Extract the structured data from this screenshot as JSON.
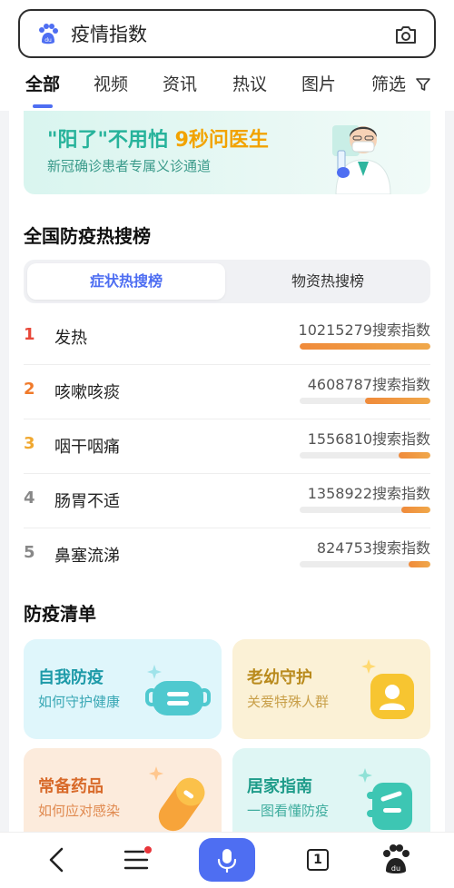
{
  "search": {
    "query": "疫情指数"
  },
  "tabs": [
    {
      "label": "全部",
      "active": true
    },
    {
      "label": "视频"
    },
    {
      "label": "资讯"
    },
    {
      "label": "热议"
    },
    {
      "label": "图片"
    },
    {
      "label": "筛选"
    }
  ],
  "banner": {
    "title_quote": "\"阳了\"不用怕",
    "title_highlight": "9秒问医生",
    "subtitle": "新冠确诊患者专属义诊通道"
  },
  "hot_search": {
    "title": "全国防疫热搜榜",
    "segments": [
      "症状热搜榜",
      "物资热搜榜"
    ],
    "selected": "症状热搜榜",
    "items": [
      {
        "rank": "1",
        "name": "发热",
        "index_text": "10215279搜索指数",
        "level": 1.0,
        "color": "#e8483a"
      },
      {
        "rank": "2",
        "name": "咳嗽咳痰",
        "index_text": "4608787搜索指数",
        "level": 0.5,
        "color": "#f07a2a"
      },
      {
        "rank": "3",
        "name": "咽干咽痛",
        "index_text": "1556810搜索指数",
        "level": 0.24,
        "color": "#f0a830"
      },
      {
        "rank": "4",
        "name": "肠胃不适",
        "index_text": "1358922搜索指数",
        "level": 0.22,
        "color": "#888888"
      },
      {
        "rank": "5",
        "name": "鼻塞流涕",
        "index_text": "824753搜索指数",
        "level": 0.17,
        "color": "#888888"
      }
    ]
  },
  "checklist": {
    "title": "防疫清单",
    "cards": [
      {
        "title": "自我防疫",
        "subtitle": "如何守护健康",
        "icon": "mask-icon"
      },
      {
        "title": "老幼守护",
        "subtitle": "关爱特殊人群",
        "icon": "person-card-icon"
      },
      {
        "title": "常备药品",
        "subtitle": "如何应对感染",
        "icon": "pill-icon"
      },
      {
        "title": "居家指南",
        "subtitle": "一图看懂防疫",
        "icon": "home-guide-icon"
      }
    ]
  },
  "bottom_bar": {
    "tab_count": "1"
  },
  "colors": {
    "accent": "#4e6ef2",
    "teal": "#27b39b",
    "orange": "#f2a300"
  }
}
